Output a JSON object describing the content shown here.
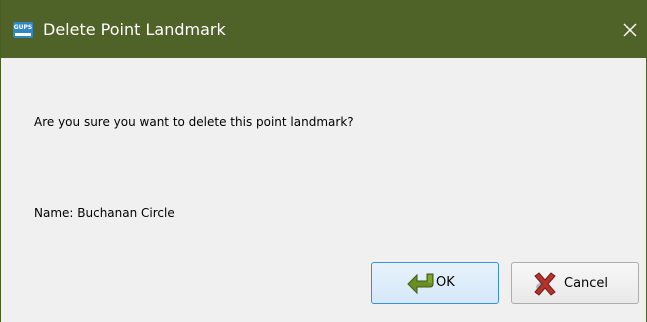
{
  "window": {
    "title": "Delete Point Landmark",
    "app_icon_label": "GUPS",
    "title_bar_color": "#4f6228"
  },
  "dialog": {
    "message": "Are you sure you want to delete this point landmark?",
    "name_line": "Name: Buchanan Circle"
  },
  "buttons": {
    "ok_label": "OK",
    "cancel_label": "Cancel"
  },
  "icons": {
    "app": "gups-app-icon",
    "close": "close-icon",
    "ok": "green-arrow-icon",
    "cancel": "red-x-icon"
  }
}
